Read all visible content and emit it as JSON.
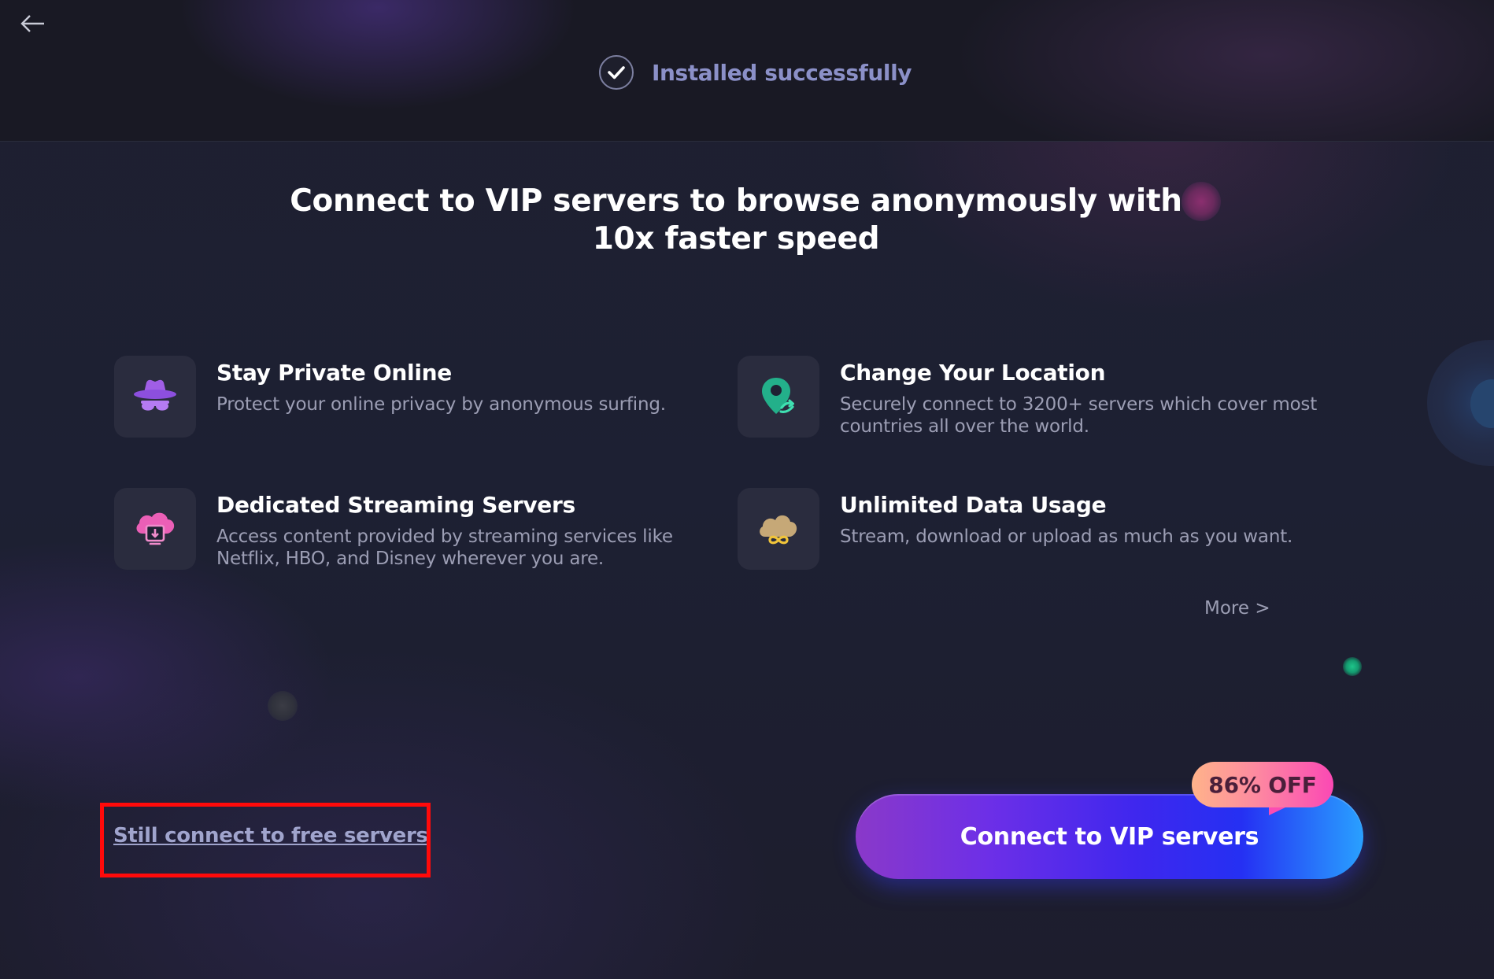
{
  "header": {
    "back_icon": "arrow-left-icon",
    "status_icon": "check-circle-icon",
    "status_text": "Installed successfully"
  },
  "headline": {
    "line1": "Connect to VIP servers to browse anonymously with",
    "line2": "10x faster speed"
  },
  "features": [
    {
      "icon": "incognito-icon",
      "title": "Stay Private Online",
      "description_lines": [
        "Protect your online privacy by anonymous surfing."
      ]
    },
    {
      "icon": "location-pin-icon",
      "title": "Change Your Location",
      "description_lines": [
        "Securely connect to 3200+ servers which cover most",
        "countries all over the world."
      ]
    },
    {
      "icon": "streaming-cloud-icon",
      "title": "Dedicated Streaming Servers",
      "description_lines": [
        "Access content provided by streaming services like",
        "Netflix, HBO, and Disney wherever you are."
      ]
    },
    {
      "icon": "unlimited-data-cloud-icon",
      "title": "Unlimited Data Usage",
      "description_lines": [
        "Stream, download or upload as much as you want."
      ]
    }
  ],
  "more_link": "More >",
  "free_servers_link": "Still connect to free servers",
  "vip_button": {
    "label": "Connect to VIP servers",
    "badge": "86% OFF"
  },
  "colors": {
    "background": "#1b1d2d",
    "header_background": "#191924",
    "status_text": "#8b90c8",
    "feature_icon_tile": "#2a2c3e",
    "muted_text": "#9c9eb4",
    "highlight_box": "#ff0a0a",
    "button_gradient_start": "#8a39c9",
    "button_gradient_end": "#29a0ff",
    "badge_gradient_start": "#ffb38a",
    "badge_gradient_end": "#fb49b4"
  }
}
